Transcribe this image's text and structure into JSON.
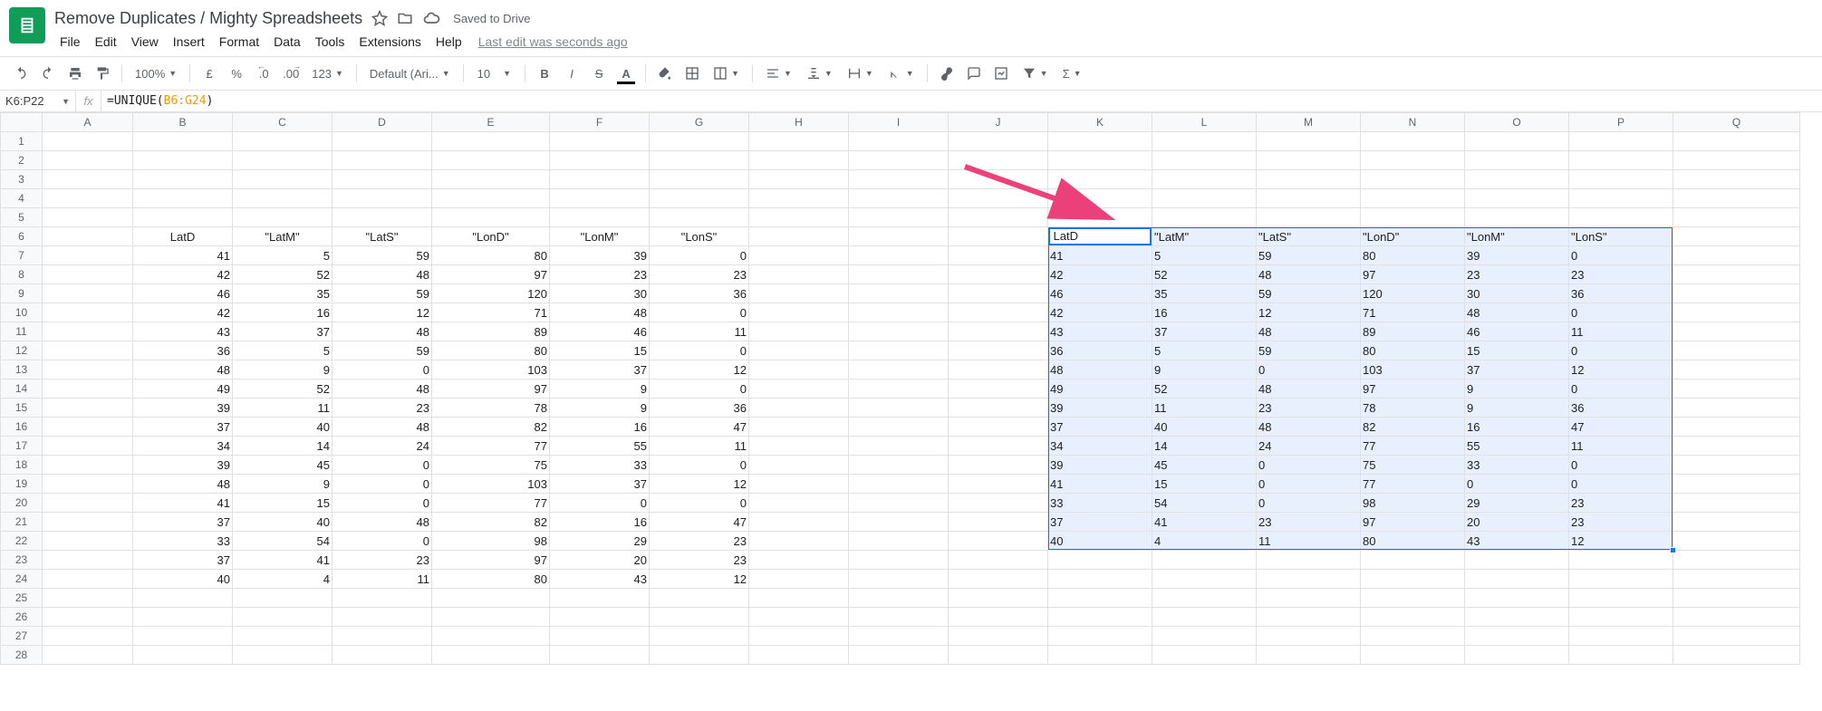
{
  "title": "Remove Duplicates / Mighty Spreadsheets",
  "savedStatus": "Saved to Drive",
  "menus": [
    "File",
    "Edit",
    "View",
    "Insert",
    "Format",
    "Data",
    "Tools",
    "Extensions",
    "Help"
  ],
  "lastEdit": "Last edit was seconds ago",
  "toolbar": {
    "zoom": "100%",
    "currency": "£",
    "percent": "%",
    "dec_dec": ".0",
    "dec_inc": ".00",
    "numfmt": "123",
    "font": "Default (Ari...",
    "size": "10"
  },
  "nameBox": "K6:P22",
  "fxLabel": "fx",
  "formula_prefix": "=UNIQUE(",
  "formula_range": "B6:G24",
  "formula_suffix": ")",
  "columns": [
    "A",
    "B",
    "C",
    "D",
    "E",
    "F",
    "G",
    "H",
    "I",
    "J",
    "K",
    "L",
    "M",
    "N",
    "O",
    "P",
    "Q"
  ],
  "rowCount": 28,
  "leftHeaders": [
    "LatD",
    "\"LatM\"",
    "\"LatS\"",
    "\"LonD\"",
    "\"LonM\"",
    "\"LonS\""
  ],
  "leftData": [
    [
      41,
      5,
      59,
      80,
      39,
      0
    ],
    [
      42,
      52,
      48,
      97,
      23,
      23
    ],
    [
      46,
      35,
      59,
      120,
      30,
      36
    ],
    [
      42,
      16,
      12,
      71,
      48,
      0
    ],
    [
      43,
      37,
      48,
      89,
      46,
      11
    ],
    [
      36,
      5,
      59,
      80,
      15,
      0
    ],
    [
      48,
      9,
      0,
      103,
      37,
      12
    ],
    [
      49,
      52,
      48,
      97,
      9,
      0
    ],
    [
      39,
      11,
      23,
      78,
      9,
      36
    ],
    [
      37,
      40,
      48,
      82,
      16,
      47
    ],
    [
      34,
      14,
      24,
      77,
      55,
      11
    ],
    [
      39,
      45,
      0,
      75,
      33,
      0
    ],
    [
      48,
      9,
      0,
      103,
      37,
      12
    ],
    [
      41,
      15,
      0,
      77,
      0,
      0
    ],
    [
      37,
      40,
      48,
      82,
      16,
      47
    ],
    [
      33,
      54,
      0,
      98,
      29,
      23
    ],
    [
      37,
      41,
      23,
      97,
      20,
      23
    ],
    [
      40,
      4,
      11,
      80,
      43,
      12
    ]
  ],
  "rightHeaders": [
    "LatD",
    "\"LatM\"",
    "\"LatS\"",
    "\"LonD\"",
    "\"LonM\"",
    "\"LonS\""
  ],
  "rightData": [
    [
      41,
      5,
      59,
      80,
      39,
      0
    ],
    [
      42,
      52,
      48,
      97,
      23,
      23
    ],
    [
      46,
      35,
      59,
      120,
      30,
      36
    ],
    [
      42,
      16,
      12,
      71,
      48,
      0
    ],
    [
      43,
      37,
      48,
      89,
      46,
      11
    ],
    [
      36,
      5,
      59,
      80,
      15,
      0
    ],
    [
      48,
      9,
      0,
      103,
      37,
      12
    ],
    [
      49,
      52,
      48,
      97,
      9,
      0
    ],
    [
      39,
      11,
      23,
      78,
      9,
      36
    ],
    [
      37,
      40,
      48,
      82,
      16,
      47
    ],
    [
      34,
      14,
      24,
      77,
      55,
      11
    ],
    [
      39,
      45,
      0,
      75,
      33,
      0
    ],
    [
      41,
      15,
      0,
      77,
      0,
      0
    ],
    [
      33,
      54,
      0,
      98,
      29,
      23
    ],
    [
      37,
      41,
      23,
      97,
      20,
      23
    ],
    [
      40,
      4,
      11,
      80,
      43,
      12
    ]
  ]
}
